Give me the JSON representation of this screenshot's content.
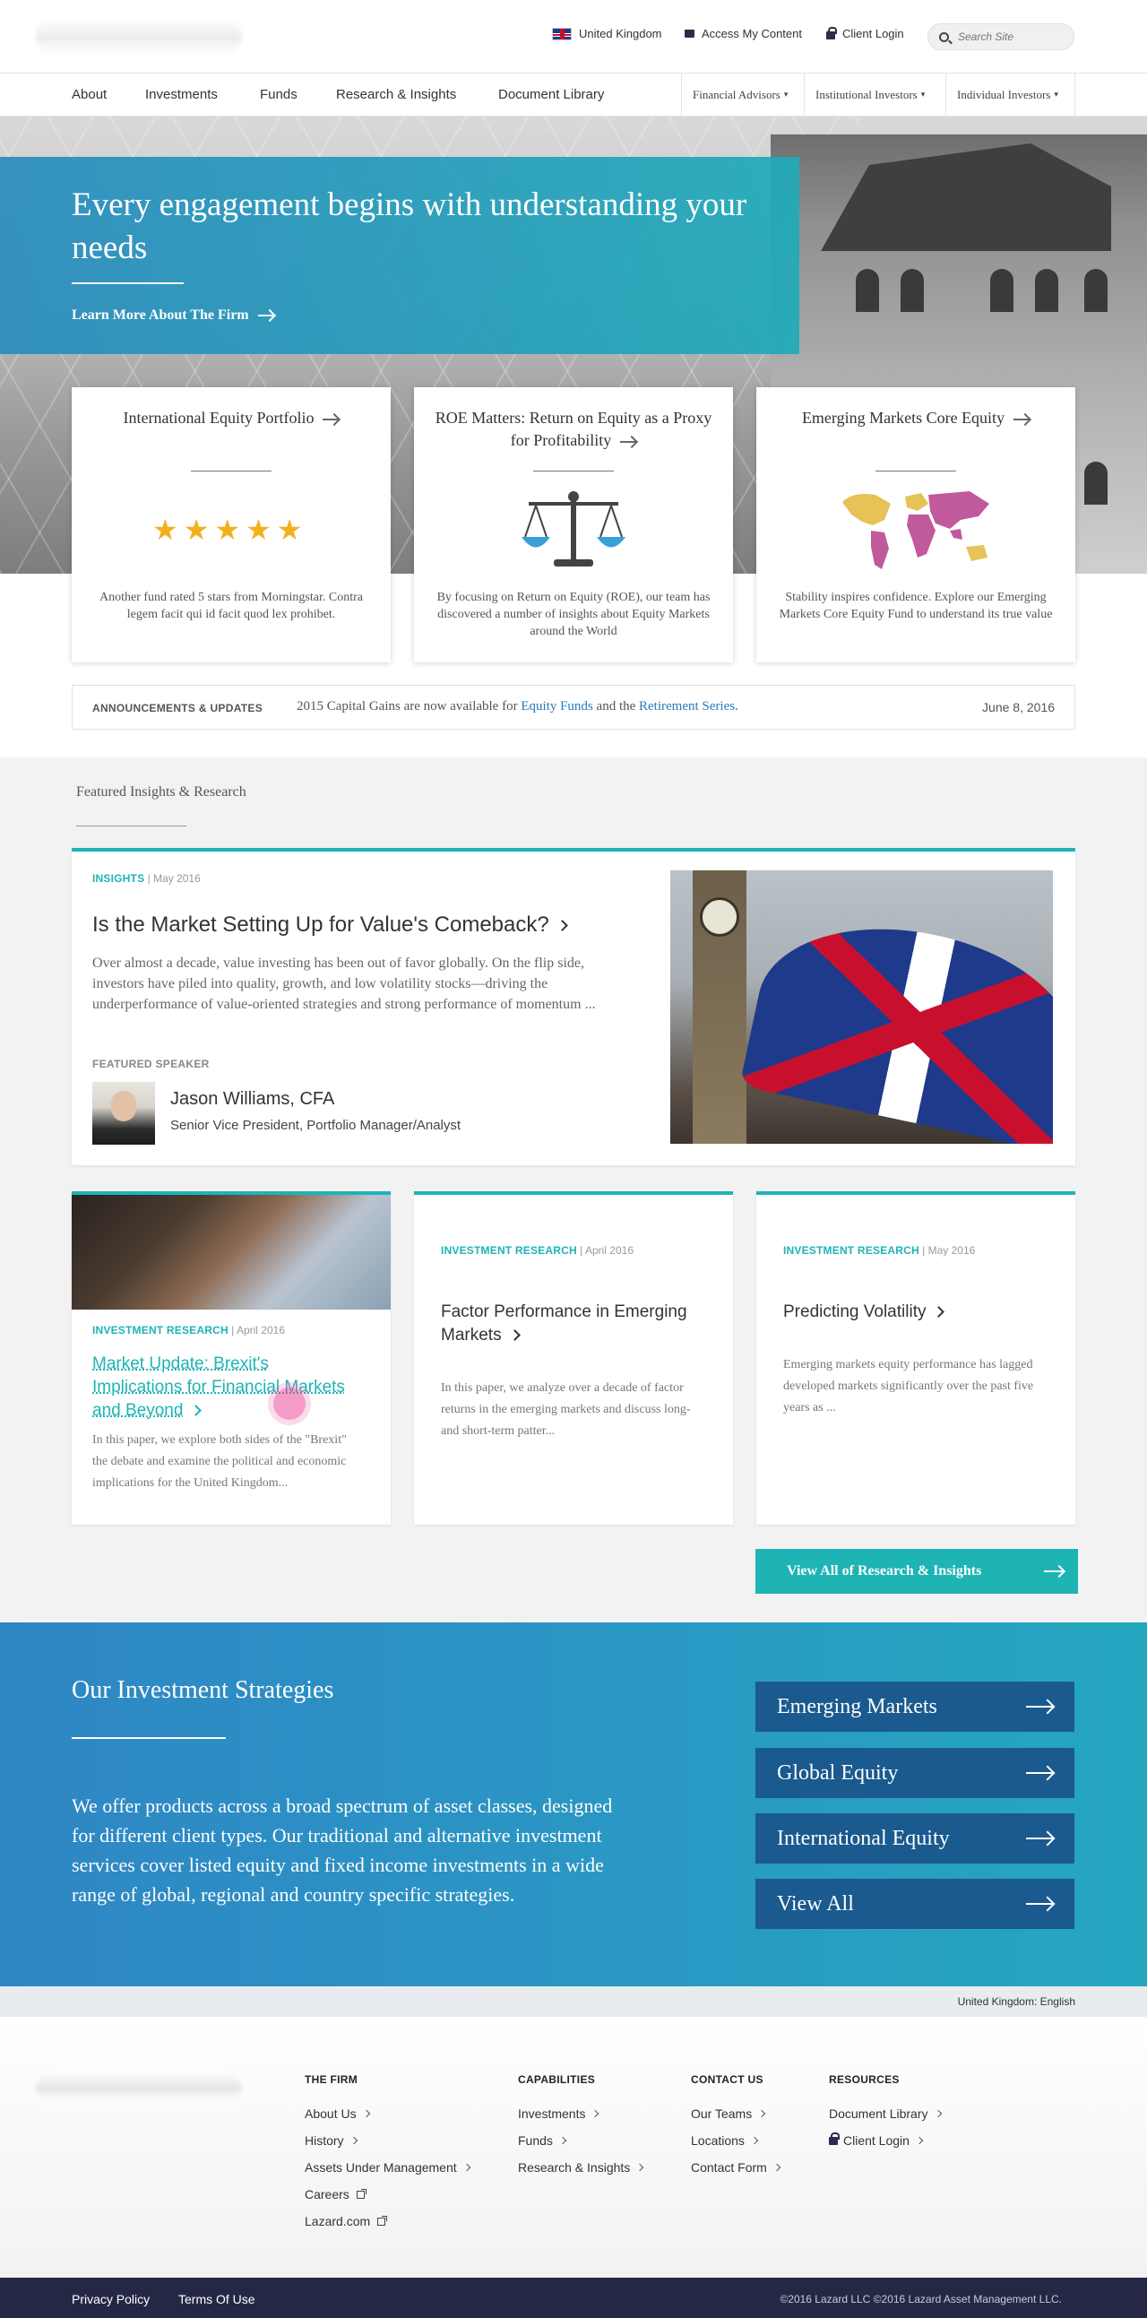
{
  "header": {
    "region": "United Kingdom",
    "access": "Access My Content",
    "client_login": "Client Login",
    "search_placeholder": "Search Site"
  },
  "nav": {
    "items": [
      "About",
      "Investments",
      "Funds",
      "Research & Insights",
      "Document Library"
    ],
    "audiences": [
      "Financial Advisors",
      "Institutional Investors",
      "Individual Investors"
    ]
  },
  "hero": {
    "title": "Every engagement begins with understanding your needs",
    "link": "Learn More About The Firm"
  },
  "cards": [
    {
      "title": "International Equity Portfolio",
      "desc": "Another fund rated 5 stars from Morningstar. Contra legem facit qui id facit quod lex prohibet.",
      "rating": 5
    },
    {
      "title": "ROE Matters: Return on Equity as a Proxy for Profitability",
      "desc": "By focusing on Return on Equity (ROE), our team has discovered a number of insights about Equity Markets around the World"
    },
    {
      "title": "Emerging Markets Core Equity",
      "desc": "Stability inspires confidence. Explore our Emerging Markets Core Equity Fund to understand its true value"
    }
  ],
  "announcement": {
    "label": "ANNOUNCEMENTS & UPDATES",
    "text_pre": "2015 Capital Gains are now available for",
    "link1": "Equity Funds",
    "text_mid": "and the",
    "link2": "Retirement Series",
    "text_post": ".",
    "date": "June 8, 2016"
  },
  "featured": {
    "section_title": "Featured Insights & Research",
    "main": {
      "category": "INSIGHTS",
      "date": "May 2016",
      "title": "Is the Market Setting Up for Value's Comeback?",
      "excerpt": "Over almost a decade, value investing has been out of favor globally. On the flip side, investors have piled into quality, growth, and low volatility stocks—driving the underperformance of value-oriented strategies and strong performance of momentum ...",
      "speaker_label": "FEATURED SPEAKER",
      "speaker_name": "Jason Williams, CFA",
      "speaker_role": "Senior Vice President, Portfolio Manager/Analyst"
    },
    "articles": [
      {
        "category": "INVESTMENT RESEARCH",
        "date": "April 2016",
        "title": "Market Update: Brexit's Implications for Financial Markets and Beyond",
        "excerpt": "In this paper, we explore both sides of the \"Brexit\" the debate and examine the political and economic implications for the United Kingdom..."
      },
      {
        "category": "INVESTMENT RESEARCH",
        "date": "April 2016",
        "title": "Factor Performance in Emerging Markets",
        "excerpt": "In this paper, we analyze over a decade of factor returns in the emerging markets and discuss long- and short-term patter..."
      },
      {
        "category": "INVESTMENT RESEARCH",
        "date": "May 2016",
        "title": "Predicting Volatility",
        "excerpt": "Emerging markets equity performance has lagged developed markets significantly over the past five years as ..."
      }
    ],
    "view_all": "View All of  Research & Insights"
  },
  "strategies": {
    "title": "Our Investment Strategies",
    "body": "We offer products across a broad spectrum of asset classes, designed for different client types. Our traditional and alternative investment services cover listed equity and fixed income investments in a wide range of global, regional and country specific strategies.",
    "buttons": [
      "Emerging Markets",
      "Global Equity",
      "International Equity",
      "View All"
    ]
  },
  "locale": "United Kingdom: English",
  "footer": {
    "columns": [
      {
        "heading": "THE FIRM",
        "links": [
          "About Us",
          "History",
          "Assets Under Management",
          "Careers",
          "Lazard.com"
        ]
      },
      {
        "heading": "CAPABILITIES",
        "links": [
          "Investments",
          "Funds",
          "Research & Insights"
        ]
      },
      {
        "heading": "CONTACT US",
        "links": [
          "Our Teams",
          "Locations",
          "Contact Form"
        ]
      },
      {
        "heading": "RESOURCES",
        "links": [
          "Document Library",
          "Client Login"
        ]
      }
    ],
    "privacy": "Privacy Policy",
    "terms": "Terms Of Use",
    "copyright": "©2016 Lazard LLC ©2016 Lazard Asset Management LLC."
  },
  "colors": {
    "teal": "#1eb4b4",
    "navy_button": "#1a5a8e",
    "footer_bar": "#252845",
    "link_blue": "#2a7ab8",
    "star": "#f2b01e"
  },
  "icons": [
    "uk-flag-icon",
    "briefcase-icon",
    "lock-icon",
    "search-icon",
    "arrow-right-icon",
    "chevron-right-icon",
    "scale-icon",
    "world-map-icon",
    "star-icon",
    "external-link-icon"
  ]
}
